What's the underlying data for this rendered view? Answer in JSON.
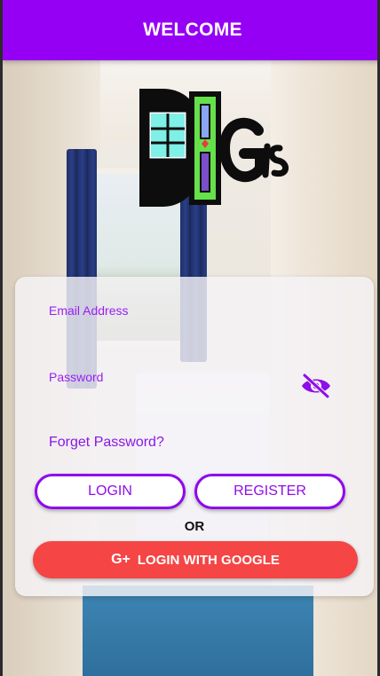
{
  "header": {
    "title": "WELCOME"
  },
  "logo": {
    "name": "digs-logo",
    "text": "DIGs"
  },
  "form": {
    "email_label": "Email Address",
    "password_label": "Password",
    "forgot_label": "Forget Password?",
    "login_label": "LOGIN",
    "register_label": "REGISTER",
    "or_label": "OR",
    "google_icon": "G+",
    "google_label": "LOGIN WITH GOOGLE"
  },
  "icons": {
    "visibility": "eye-off-icon",
    "google": "google-plus-icon"
  },
  "colors": {
    "primary": "#9500f5",
    "google": "#f54545",
    "background_card": "#f5f3f6"
  }
}
